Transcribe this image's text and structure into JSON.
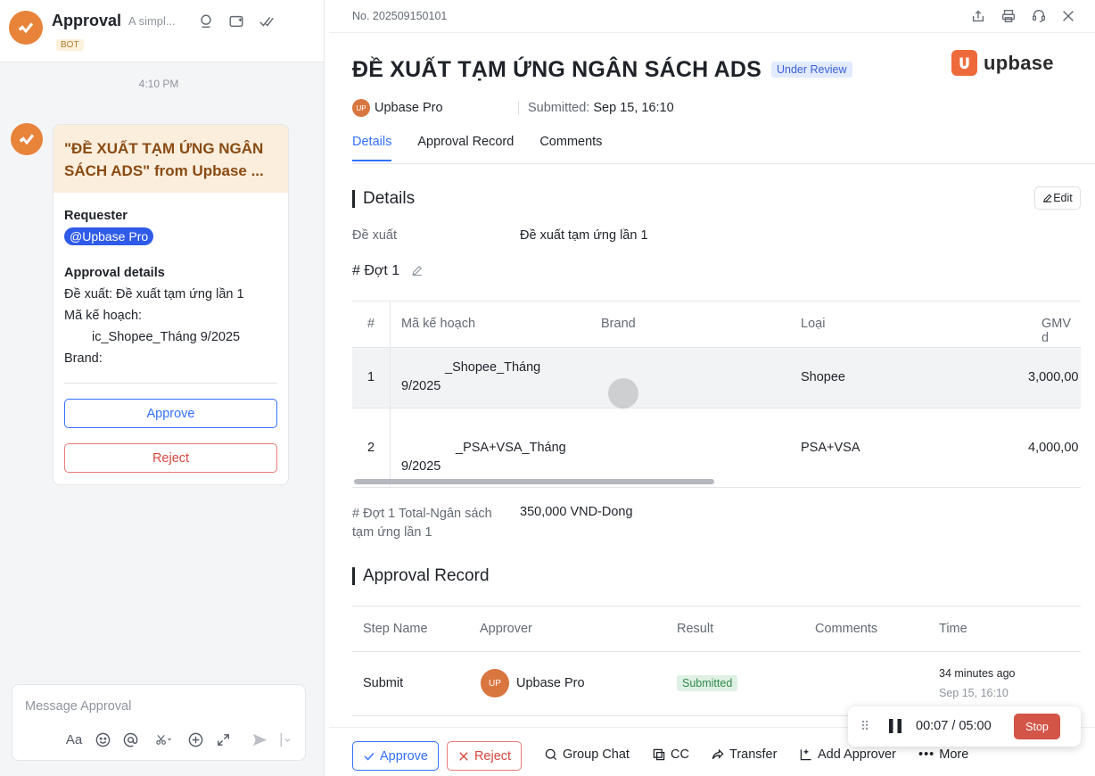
{
  "chat": {
    "title": "Approval",
    "subtitle": "A simpl...",
    "bot_tag": "BOT",
    "time": "4:10 PM",
    "card": {
      "title": "\"ĐỀ XUẤT TẠM ỨNG NGÂN SÁCH ADS\" from Upbase ...",
      "requester_label": "Requester",
      "requester_mention": "@Upbase Pro",
      "details_label": "Approval details",
      "line1": "Đề xuất: Đề xuất tạm ứng lần 1",
      "line2": "Mã kế hoạch:",
      "line3": "ic_Shopee_Tháng 9/2025",
      "line4": "Brand:",
      "approve": "Approve",
      "reject": "Reject"
    },
    "composer_placeholder": "Message Approval",
    "composer_tools": {
      "format": "Aa"
    }
  },
  "detail": {
    "doc_no": "No. 202509150101",
    "title": "ĐỀ XUẤT TẠM ỨNG NGÂN SÁCH ADS",
    "status": "Under Review",
    "logo_text": "upbase",
    "requester_initials": "UP",
    "requester": "Upbase Pro",
    "submitted_label": "Submitted:",
    "submitted_value": "Sep 15, 16:10",
    "tabs": [
      "Details",
      "Approval Record",
      "Comments"
    ],
    "details_heading": "Details",
    "edit": "Edit",
    "proposal_label": "Đề xuất",
    "proposal_value": "Đề xuất tạm ứng lần 1",
    "round_label": "# Đợt 1",
    "table": {
      "headers": [
        "#",
        "Mã kế hoạch",
        "Brand",
        "Loại",
        "GMV d"
      ],
      "rows": [
        {
          "num": "1",
          "code_line1": "_Shopee_Tháng",
          "code_line2": "9/2025",
          "type": "Shopee",
          "gmv": "3,000,00"
        },
        {
          "num": "2",
          "code_line1": "_PSA+VSA_Tháng",
          "code_line2": "9/2025",
          "type": "PSA+VSA",
          "gmv": "4,000,00"
        }
      ]
    },
    "total_label": "# Đợt 1 Total-Ngân sách tạm ứng lần 1",
    "total_value": "350,000 VND-Dong",
    "record_heading": "Approval Record",
    "record": {
      "headers": [
        "Step Name",
        "Approver",
        "Result",
        "Comments",
        "Time"
      ],
      "step": "Submit",
      "approver_initials": "UP",
      "approver": "Upbase Pro",
      "result": "Submitted",
      "time_relative": "34 minutes ago",
      "time_abs": "Sep 15, 16:10"
    },
    "actions": {
      "approve": "Approve",
      "reject": "Reject",
      "group_chat": "Group Chat",
      "cc": "CC",
      "transfer": "Transfer",
      "add_approver": "Add Approver",
      "more": "More"
    }
  },
  "recorder": {
    "time": "00:07 / 05:00",
    "stop": "Stop"
  },
  "colors": {
    "accent": "#3370ff",
    "brand": "#ef6a3a",
    "reject": "#d6483f",
    "card_header": "#fbeedd"
  }
}
